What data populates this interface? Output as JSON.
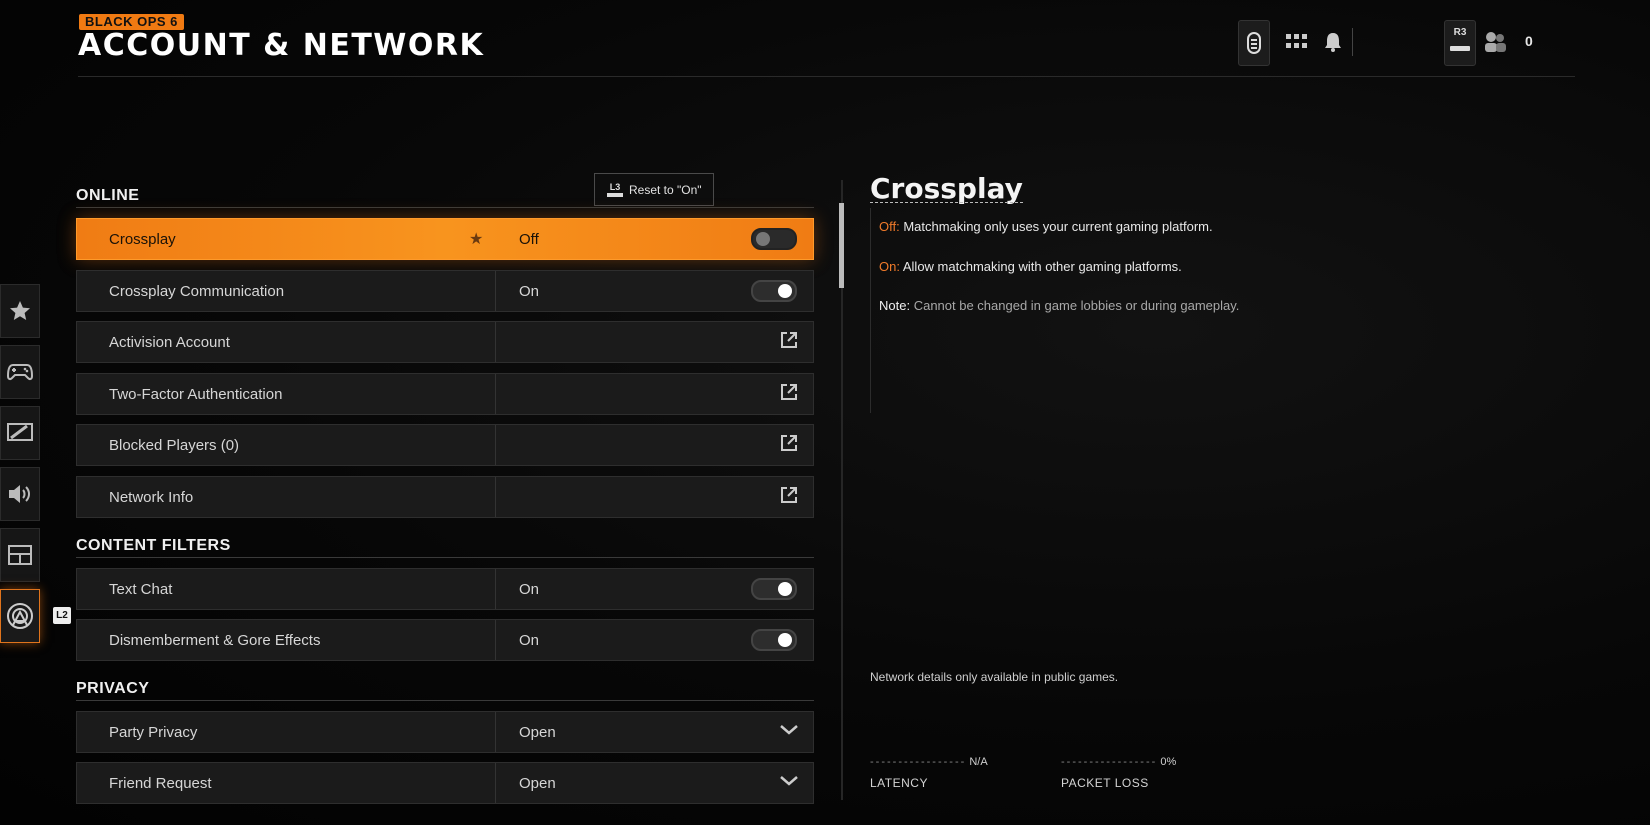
{
  "header": {
    "brand": "BLACK OPS 6",
    "title": "ACCOUNT & NETWORK",
    "r3_label": "R3",
    "friend_count": "0"
  },
  "nav": {
    "items": [
      {
        "icon": "star-icon"
      },
      {
        "icon": "controller-icon"
      },
      {
        "icon": "display-icon"
      },
      {
        "icon": "speaker-icon"
      },
      {
        "icon": "interface-icon"
      },
      {
        "icon": "network-icon",
        "active": true
      }
    ],
    "l2_label": "L2"
  },
  "tooltip": {
    "key": "L3",
    "text": "Reset to \"On\""
  },
  "sections": {
    "online": "ONLINE",
    "content_filters": "CONTENT FILTERS",
    "privacy": "PRIVACY"
  },
  "rows": {
    "crossplay": {
      "label": "Crossplay",
      "value": "Off",
      "toggle": "off"
    },
    "crossplay_comm": {
      "label": "Crossplay Communication",
      "value": "On",
      "toggle": "on"
    },
    "activision": {
      "label": "Activision Account"
    },
    "two_factor": {
      "label": "Two-Factor Authentication"
    },
    "blocked": {
      "label": "Blocked Players (0)"
    },
    "network_info": {
      "label": "Network Info"
    },
    "text_chat": {
      "label": "Text Chat",
      "value": "On",
      "toggle": "on"
    },
    "gore": {
      "label": "Dismemberment & Gore Effects",
      "value": "On",
      "toggle": "on"
    },
    "party_privacy": {
      "label": "Party Privacy",
      "value": "Open"
    },
    "friend_request": {
      "label": "Friend Request",
      "value": "Open"
    }
  },
  "description": {
    "title": "Crossplay",
    "off_key": "Off:",
    "off_text": "Matchmaking only uses your current gaming platform.",
    "on_key": "On:",
    "on_text": "Allow matchmaking with other gaming platforms.",
    "note_key": "Note:",
    "note_text": "Cannot be changed in game lobbies or during gameplay."
  },
  "network": {
    "note": "Network details only available in public games.",
    "latency_value": "N/A",
    "latency_label": "LATENCY",
    "packet_value": "0%",
    "packet_label": "PACKET LOSS"
  },
  "colors": {
    "accent": "#f07c14",
    "highlight_text": "#f07a2a"
  }
}
